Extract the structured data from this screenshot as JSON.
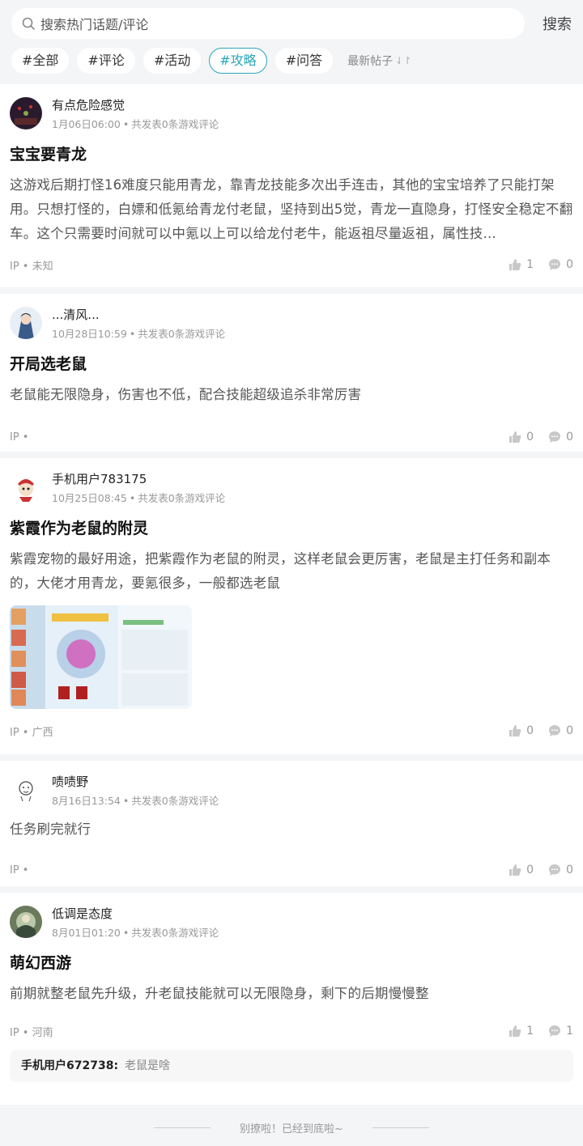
{
  "search": {
    "placeholder": "搜索热门话题/评论",
    "button": "搜索"
  },
  "tags": [
    "#全部",
    "#评论",
    "#活动",
    "#攻略",
    "#问答"
  ],
  "active_tag": "#攻略",
  "sort_label": "最新帖子",
  "colors": {
    "accent": "#2aa6b8",
    "bg": "#f4f5f7"
  },
  "posts": [
    {
      "username": "有点危险感觉",
      "time": "1月06日06:00",
      "meta": "共发表0条游戏评论",
      "title": "宝宝要青龙",
      "body": "这游戏后期打怪16难度只能用青龙，靠青龙技能多次出手连击，其他的宝宝培养了只能打架用。只想打怪的，白嫖和低氪给青龙付老鼠，坚持到出5觉，青龙一直隐身，打怪安全稳定不翻车。这个只需要时间就可以中氪以上可以给龙付老牛，能返祖尽量返祖，属性技...",
      "ip": "IP • 未知",
      "likes": "1",
      "comments": "0"
    },
    {
      "username": "...清风...",
      "time": "10月28日10:59",
      "meta": "共发表0条游戏评论",
      "title": "开局选老鼠",
      "body": "老鼠能无限隐身，伤害也不低，配合技能超级追杀非常厉害",
      "ip": "IP •",
      "likes": "0",
      "comments": "0"
    },
    {
      "username": "手机用户783175",
      "time": "10月25日08:45",
      "meta": "共发表0条游戏评论",
      "title": "紫霞作为老鼠的附灵",
      "body": "紫霞宠物的最好用途，把紫霞作为老鼠的附灵，这样老鼠会更厉害，老鼠是主打任务和副本的，大佬才用青龙，要氪很多，一般都选老鼠",
      "ip": "IP • 广西",
      "likes": "0",
      "comments": "0"
    },
    {
      "username": "啧啧野",
      "time": "8月16日13:54",
      "meta": "共发表0条游戏评论",
      "title": "",
      "body": "任务刷完就行",
      "ip": "IP •",
      "likes": "0",
      "comments": "0"
    },
    {
      "username": "低调是态度",
      "time": "8月01日01:20",
      "meta": "共发表0条游戏评论",
      "title": "萌幻西游",
      "body": "前期就整老鼠先升级，升老鼠技能就可以无限隐身，剩下的后期慢慢整",
      "ip": "IP • 河南",
      "likes": "1",
      "comments": "1",
      "reply": {
        "user": "手机用户672738:",
        "text": "老鼠是啥"
      }
    }
  ],
  "footer_text": "别撩啦！已经到底啦~"
}
